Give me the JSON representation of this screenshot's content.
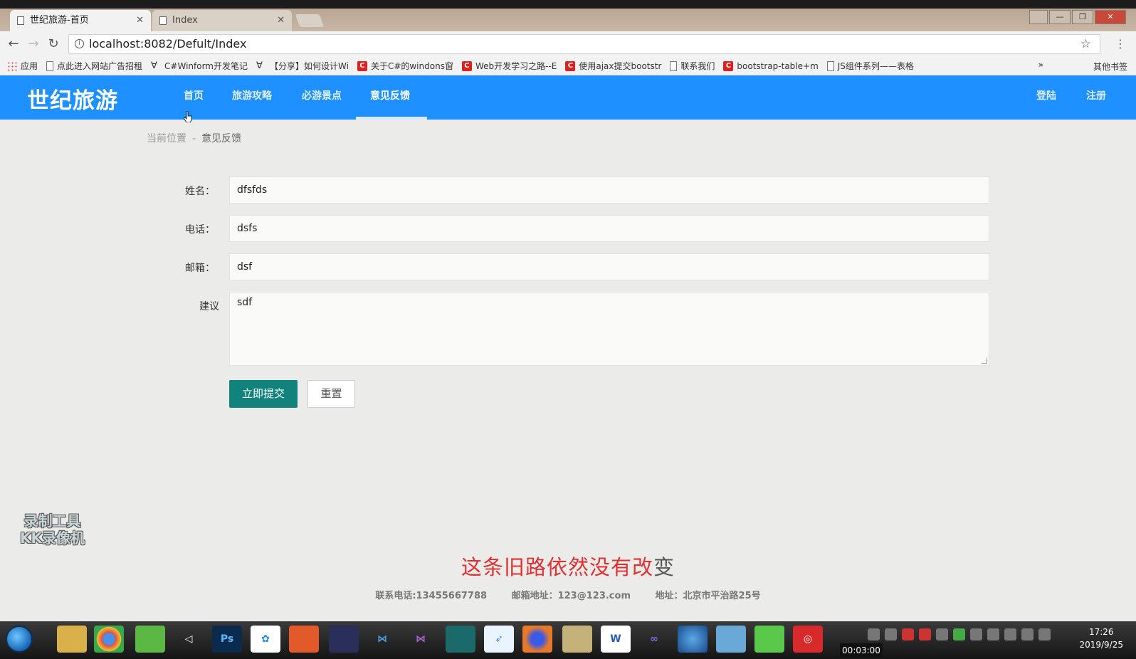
{
  "browser": {
    "tabs": [
      {
        "title": "世纪旅游-首页",
        "active": true
      },
      {
        "title": "Index",
        "active": false
      }
    ],
    "url": "localhost:8082/Defult/Index",
    "bookmarks": [
      {
        "icon": "apps-icon",
        "label": "应用"
      },
      {
        "icon": "doc-icon",
        "label": "点此进入网站广告招租"
      },
      {
        "icon": "wrench-icon",
        "label": "C#Winform开发笔记"
      },
      {
        "icon": "wrench-icon",
        "label": "【分享】如何设计Wi"
      },
      {
        "icon": "csdn-icon",
        "label": "关于C#的windons窗"
      },
      {
        "icon": "csdn-icon",
        "label": "Web开发学习之路--E"
      },
      {
        "icon": "csdn-icon",
        "label": "使用ajax提交bootstr"
      },
      {
        "icon": "doc-icon",
        "label": "联系我们"
      },
      {
        "icon": "csdn-icon",
        "label": "bootstrap-table+m"
      },
      {
        "icon": "doc-icon",
        "label": "JS组件系列——表格"
      }
    ],
    "bookmarks_more": "»",
    "other_bookmarks": "其他书签"
  },
  "site": {
    "logo": "世纪旅游",
    "nav": [
      {
        "label": "首页",
        "active": false
      },
      {
        "label": "旅游攻略",
        "active": false
      },
      {
        "label": "必游景点",
        "active": false
      },
      {
        "label": "意见反馈",
        "active": true
      }
    ],
    "login": "登陆",
    "register": "注册",
    "accent_color": "#1e90ff"
  },
  "breadcrumb": {
    "prefix": "当前位置",
    "separator": "-",
    "current": "意见反馈"
  },
  "form": {
    "name_label": "姓名：",
    "name_value": "dfsfds",
    "phone_label": "电话：",
    "phone_value": "dsfs",
    "email_label": "邮箱：",
    "email_value": "dsf",
    "suggestion_label": "建议",
    "suggestion_value": "sdf",
    "submit_label": "立即提交",
    "reset_label": "重置",
    "submit_color": "#12837c"
  },
  "overlay": {
    "watermark_line1": "录制工具",
    "watermark_line2": "KK录像机",
    "subtitle_red": "这条旧路依然没有改",
    "subtitle_last": "变",
    "recording_time": "00:03:00"
  },
  "footer": {
    "phone": "联系电话:13455667788",
    "email": "邮箱地址：123@123.com",
    "address": "地址：北京市平治路25号"
  },
  "taskbar": {
    "time": "17:26",
    "date": "2019/9/25"
  }
}
